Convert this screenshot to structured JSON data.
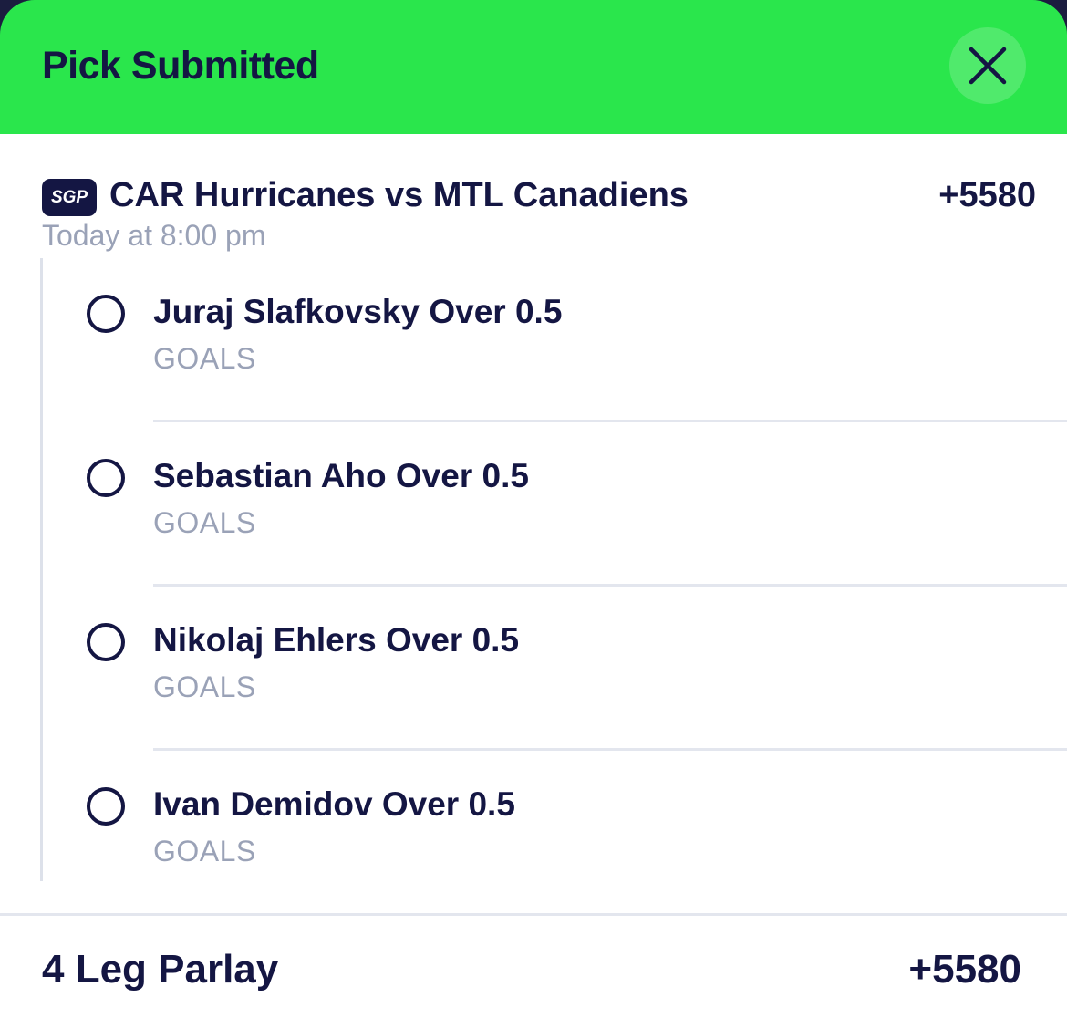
{
  "header": {
    "title": "Pick Submitted",
    "close_icon": "close-icon",
    "background_color": "#2ae64c"
  },
  "event": {
    "badge": "SGP",
    "title": "CAR Hurricanes vs MTL Canadiens",
    "odds": "+5580",
    "time": "Today at 8:00 pm"
  },
  "legs": [
    {
      "title": "Juraj Slafkovsky Over 0.5",
      "market": "GOALS"
    },
    {
      "title": "Sebastian Aho Over 0.5",
      "market": "GOALS"
    },
    {
      "title": "Nikolaj Ehlers Over 0.5",
      "market": "GOALS"
    },
    {
      "title": "Ivan Demidov Over 0.5",
      "market": "GOALS"
    }
  ],
  "parlay": {
    "label": "4 Leg Parlay",
    "odds": "+5580"
  },
  "colors": {
    "text_primary": "#141643",
    "text_secondary": "#9aa2b7",
    "accent_green": "#2ae64c"
  }
}
